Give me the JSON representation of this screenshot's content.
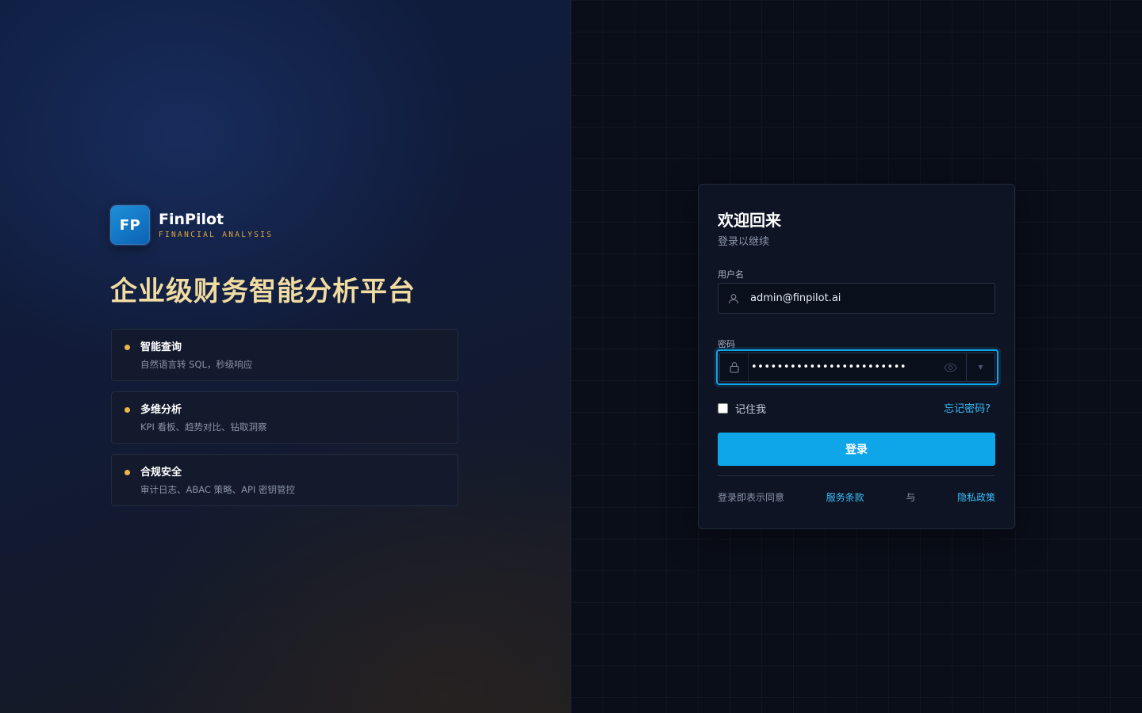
{
  "brand": {
    "logo_text": "FP",
    "name": "FinPilot",
    "tagline": "FINANCIAL ANALYSIS"
  },
  "hero": {
    "headline": "企业级财务智能分析平台"
  },
  "features": [
    {
      "title": "智能查询",
      "desc": "自然语言转 SQL，秒级响应"
    },
    {
      "title": "多维分析",
      "desc": "KPI 看板、趋势对比、钻取洞察"
    },
    {
      "title": "合规安全",
      "desc": "审计日志、ABAC 策略、API 密钥管控"
    }
  ],
  "login": {
    "title": "欢迎回来",
    "subtitle": "登录以继续",
    "username_label": "用户名",
    "username_value": "admin@finpilot.ai",
    "password_label": "密码",
    "password_mask": "••••••••••••••••••••••••",
    "remember_label": "记住我",
    "forgot_label": "忘记密码?",
    "submit_label": "登录",
    "terms_prefix": "登录即表示同意",
    "terms_link": "服务条款",
    "terms_and": "与",
    "privacy_link": "隐私政策"
  },
  "colors": {
    "accent": "#0ea5e9",
    "gold": "#e7b84a",
    "headline": "#f0dca0",
    "link": "#38bdf8"
  },
  "icons": {
    "username": "user-icon",
    "password": "lock-icon",
    "toggle": "eye-icon"
  }
}
